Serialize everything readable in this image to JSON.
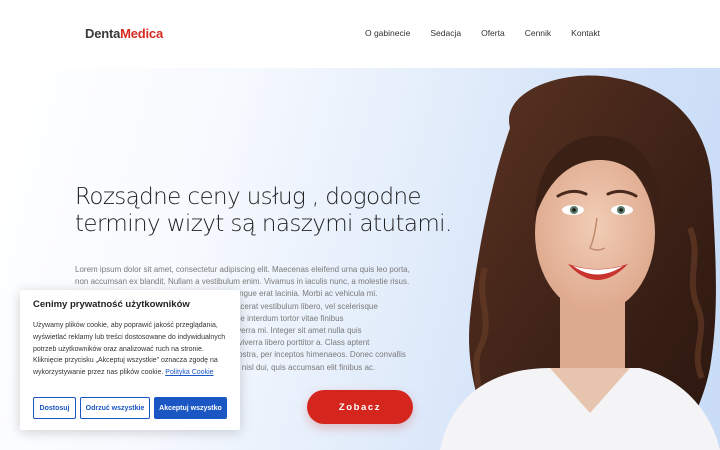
{
  "header": {
    "logo_part1": "Denta",
    "logo_part2": "Medica",
    "nav": [
      "O gabinecie",
      "Sedacja",
      "Oferta",
      "Cennik",
      "Kontakt"
    ]
  },
  "hero": {
    "headline_line1": "Rozsądne ceny usług , dogodne",
    "headline_line2": "terminy wizyt są naszymi atutami.",
    "lorem_lines": [
      "Lorem ipsum dolor sit amet, consectetur adipiscing elit. Maecenas eleifend urna quis leo porta,",
      "non accumsan ex blandit. Nullam a vestibulum enim. Vivamus in iaculis nunc, a molestie risus.",
      "Nam mollis nisl a leo dapibus accumsan, at congue erat lacinia. Morbi ac vehicula mi.",
      "Quisque dolor lectus, dignissim quis. Etiam placerat vestibulum libero, vel scelerisque",
      "tortor pulvinar vitae. Nam nec nisi lacinia. Fusce interdum tortor vitae finibus",
      "efficitur. Praesent sagittis eros nulla feugiat, viverra mi. Integer sit amet nulla quis",
      "lectus facilisis luctus. Pellentesque per erat, a viverra libero porttitor a. Class aptent",
      "taciti sociosqu ad litora torquent per conubia nostra, per inceptos himenaeos. Donec convallis",
      "mauris quis dolor ullamcorper, sed scelerisque nisl dui, quis accumsan elit finibus ac."
    ],
    "cta_label": "Zobacz"
  },
  "cookie": {
    "title": "Cenimy prywatność użytkowników",
    "text": "Używamy plików cookie, aby poprawić jakość przeglądania, wyświetlać reklamy lub treści dostosowane do indywidualnych potrzeb użytkowników oraz analizować ruch na stronie. Kliknięcie przycisku „Akceptuj wszystkie” oznacza zgodę na wykorzystywanie przez nas plików cookie. ",
    "link": "Polityka Cookie",
    "btn_customize": "Dostosuj",
    "btn_reject": "Odrzuć wszystkie",
    "btn_accept": "Akceptuj wszystko"
  },
  "colors": {
    "brand_red": "#d4261d",
    "cookie_blue": "#1a56c4"
  }
}
